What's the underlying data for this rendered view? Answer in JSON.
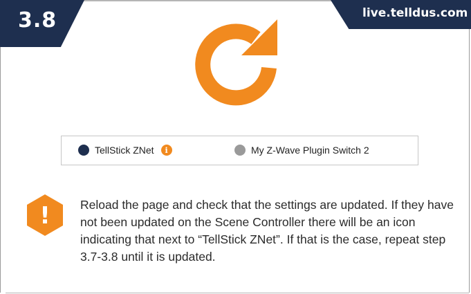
{
  "header": {
    "step_number": "3.8",
    "site": "live.telldus.com"
  },
  "icons": {
    "main": "refresh-icon",
    "warning": "exclamation-icon",
    "info": "info-icon"
  },
  "devices": [
    {
      "name": "TellStick ZNet",
      "status_color": "#1e2f4f",
      "has_info": true
    },
    {
      "name": "My Z-Wave Plugin Switch 2",
      "status_color": "#9a9a9a",
      "has_info": false
    }
  ],
  "info_glyph": "i",
  "warning_glyph": "!",
  "note": "Reload the page and check that the settings are updated. If they have not been updated on the Scene Controller there will be an icon indicating that next to “TellStick ZNet”. If that is the case, repeat step 3.7-3.8 until it is updated.",
  "colors": {
    "navy": "#1e2f4f",
    "orange": "#f18a1f",
    "grey": "#9a9a9a"
  }
}
